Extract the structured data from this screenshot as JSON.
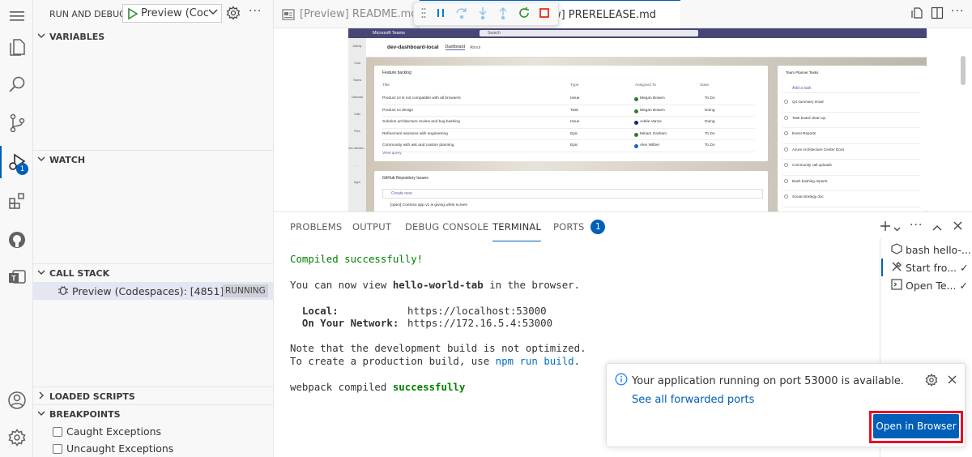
{
  "activity_bar": {
    "debug_badge": "1",
    "icons": [
      "menu-icon",
      "explorer-icon",
      "search-icon",
      "source-control-icon",
      "run-debug-icon",
      "extensions-icon",
      "github-icon",
      "teams-toolkit-icon",
      "account-icon",
      "settings-gear-icon"
    ]
  },
  "sidebar": {
    "title": "RUN AND DEBUG",
    "config_select": "Preview (Coc",
    "sections": {
      "variables": "VARIABLES",
      "watch": "WATCH",
      "call_stack": "CALL STACK",
      "loaded_scripts": "LOADED SCRIPTS",
      "breakpoints": "BREAKPOINTS"
    },
    "call_stack_item": "Preview (Codespaces): [4851]",
    "call_stack_status": "RUNNING",
    "breakpoints": [
      {
        "label": "Caught Exceptions",
        "checked": false
      },
      {
        "label": "Uncaught Exceptions",
        "checked": false
      }
    ]
  },
  "tabs": [
    {
      "label": "[Preview] README.md",
      "active": false
    },
    {
      "label": "[Preview] PRERELEASE.md",
      "active": true
    }
  ],
  "debug_toolbar": [
    "drag-handle",
    "pause",
    "step-over",
    "step-into",
    "step-out",
    "restart",
    "stop"
  ],
  "preview": {
    "teams_title": "Microsoft Teams",
    "search_placeholder": "Search",
    "app_name": "dev-dashboard-local",
    "app_tabs": [
      "Dashboard",
      "About"
    ],
    "rail": [
      "Activity",
      "Chat",
      "Teams",
      "Calendar",
      "Calls",
      "Files",
      "dev-dashbo...",
      "...",
      "Apps"
    ],
    "backlog": {
      "title": "Feature backlog",
      "headers": [
        "Title",
        "Type",
        "Assigned To",
        "State"
      ],
      "rows": [
        {
          "title": "Product UI is not compatible with all browsers",
          "type": "Issue",
          "assigned": "Megan Bowen",
          "state": "To Do",
          "color": "#2e7d32"
        },
        {
          "title": "Product UI design",
          "type": "Task",
          "assigned": "Megan Bowen",
          "state": "Doing",
          "color": "#2e7d32"
        },
        {
          "title": "Solution architecture review and bug bashing",
          "type": "Issue",
          "assigned": "Adele Vance",
          "state": "Doing",
          "color": "#1a237e"
        },
        {
          "title": "Refinement sessions with engineering",
          "type": "Epic",
          "assigned": "Miriam Graham",
          "state": "To Do",
          "color": "#2e7d32"
        },
        {
          "title": "Community with ask and custom planning",
          "type": "Epic",
          "assigned": "Alex Wilber",
          "state": "To Do",
          "color": "#1565c0"
        }
      ],
      "view_query": "View query"
    },
    "github": {
      "title": "GitHub Repository Issues",
      "create": "Create new",
      "issue": "[open] Contoso app v1 is giving white screen"
    },
    "planner": {
      "title": "Team Planner Tasks",
      "add": "Add a task",
      "tasks": [
        "Q4 summary email",
        "Task board clean up",
        "Event Reports",
        "Azure Architecture Center Docs",
        "Community call uploads",
        "Bash bashing reports",
        "Social strategy doc"
      ]
    }
  },
  "panel": {
    "tabs": [
      "PROBLEMS",
      "OUTPUT",
      "DEBUG CONSOLE",
      "TERMINAL",
      "PORTS"
    ],
    "active_tab": "TERMINAL",
    "ports_badge": "1",
    "terminal": {
      "line1": "Compiled successfully!",
      "line2a": "You can now view ",
      "line2b": "hello-world-tab",
      "line2c": " in the browser.",
      "local_label": "  Local:",
      "local_url": "https://localhost:53000",
      "network_label": "  On Your Network:",
      "network_url": "https://172.16.5.4:53000",
      "note1": "Note that the development build is not optimized.",
      "note2a": "To create a production build, use ",
      "note2b": "npm run build",
      "note2c": ".",
      "webpack_a": "webpack compiled ",
      "webpack_b": "successfully"
    },
    "terminal_list": [
      {
        "label": "bash  hello-...",
        "icon": "terminal-bash-icon"
      },
      {
        "label": "Start fro... ✓",
        "icon": "tools-icon"
      },
      {
        "label": "Open Te... ✓",
        "icon": "terminal-task-icon"
      }
    ]
  },
  "notification": {
    "message": "Your application running on port 53000 is available.",
    "link": "See all forwarded ports",
    "button": "Open in Browser",
    "highlight_color": "#e81123"
  }
}
